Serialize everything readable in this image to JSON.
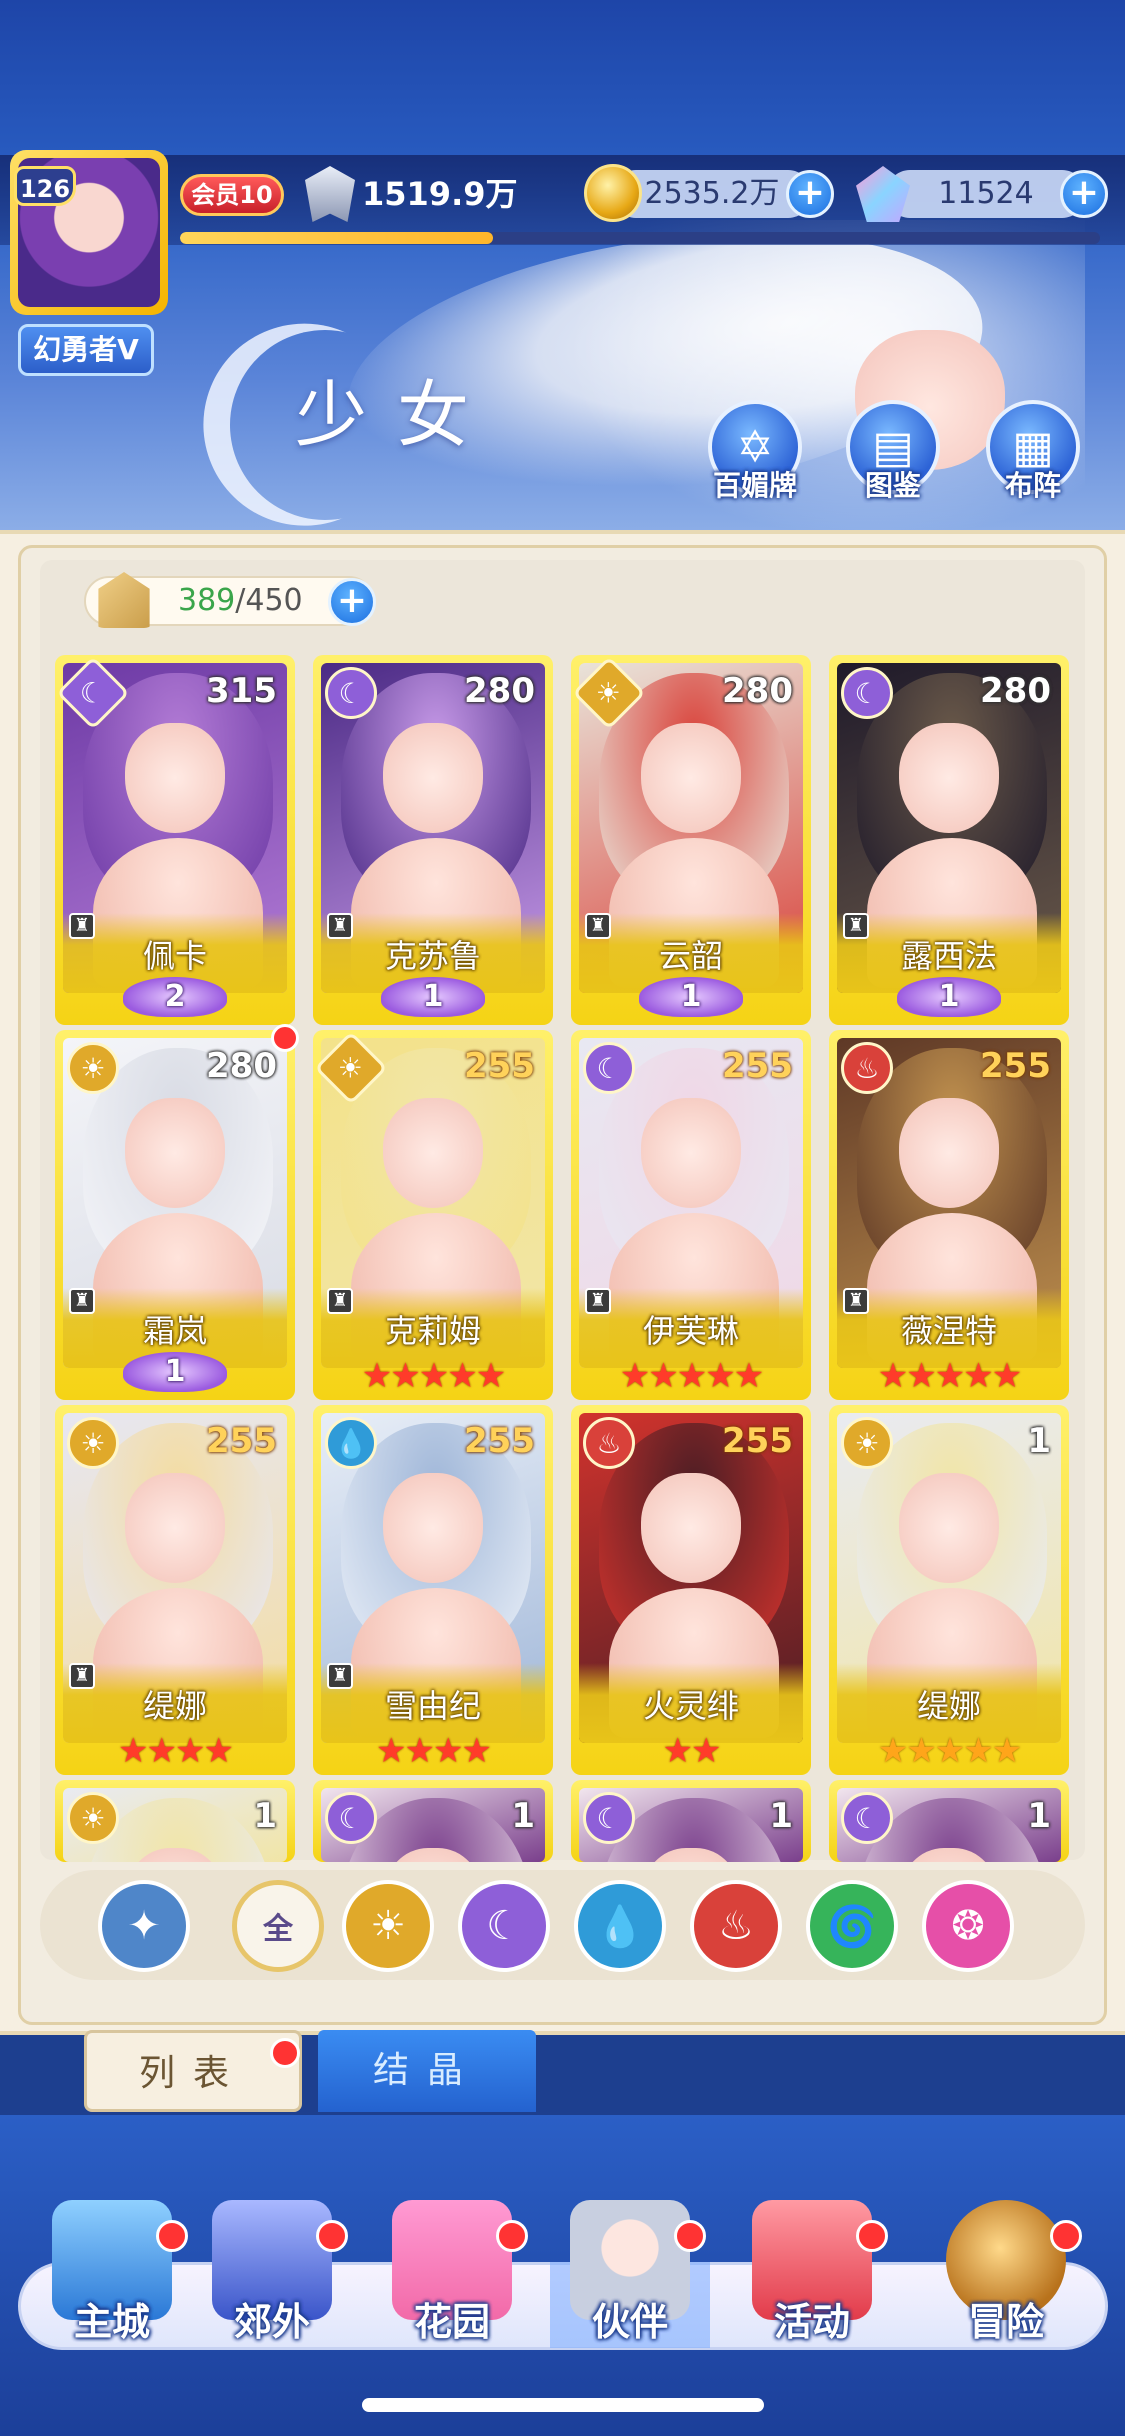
{
  "header": {
    "level": "126",
    "player_title": "幻勇者V",
    "vip": "会员10",
    "power": "1519.9万",
    "exp_progress": 0.34,
    "gold": "2535.2万",
    "gems": "11524",
    "plus_symbol": "+"
  },
  "page": {
    "title": "少女",
    "actions": [
      {
        "label": "百媚牌",
        "icon": "card-icon"
      },
      {
        "label": "图鉴",
        "icon": "book-icon"
      },
      {
        "label": "布阵",
        "icon": "grid-icon"
      }
    ]
  },
  "roster": {
    "count_current": "389",
    "count_total": "/450"
  },
  "cards": [
    {
      "name": "佩卡",
      "level": "315",
      "element": "moon",
      "wing": "2",
      "stars": 0
    },
    {
      "name": "克苏鲁",
      "level": "280",
      "element": "moon",
      "wing": "1",
      "stars": 0
    },
    {
      "name": "云韶",
      "level": "280",
      "element": "sun",
      "wing": "1",
      "stars": 0
    },
    {
      "name": "露西法",
      "level": "280",
      "element": "moon",
      "wing": "1",
      "stars": 0
    },
    {
      "name": "霜岚",
      "level": "280",
      "element": "sun",
      "wing": "1",
      "stars": 0,
      "alert": true
    },
    {
      "name": "克莉姆",
      "level": "255",
      "element": "sun",
      "stars": 5
    },
    {
      "name": "伊芙琳",
      "level": "255",
      "element": "moon",
      "stars": 5
    },
    {
      "name": "薇涅特",
      "level": "255",
      "element": "fire",
      "stars": 5
    },
    {
      "name": "缇娜",
      "level": "255",
      "element": "sun",
      "stars": 4
    },
    {
      "name": "雪由纪",
      "level": "255",
      "element": "water",
      "stars": 4
    },
    {
      "name": "火灵绯",
      "level": "255",
      "element": "fire",
      "stars": 2
    },
    {
      "name": "缇娜",
      "level": "1",
      "element": "sun",
      "stars": 5,
      "gold_stars": true
    },
    {
      "name": "",
      "level": "1",
      "element": "sun"
    },
    {
      "name": "",
      "level": "1",
      "element": "moon"
    },
    {
      "name": "",
      "level": "1",
      "element": "moon"
    },
    {
      "name": "",
      "level": "1",
      "element": "moon"
    }
  ],
  "filters": [
    {
      "name": "rank",
      "label": "",
      "color": "#4f86c9"
    },
    {
      "name": "all",
      "label": "全",
      "color": "#f9f4ea"
    },
    {
      "name": "sun",
      "label": "",
      "color": "#e0a92a"
    },
    {
      "name": "moon",
      "label": "",
      "color": "#8e5fd8"
    },
    {
      "name": "water",
      "label": "",
      "color": "#2f9bd8"
    },
    {
      "name": "fire",
      "label": "",
      "color": "#d9413a"
    },
    {
      "name": "wind",
      "label": "",
      "color": "#36b45a"
    },
    {
      "name": "heart",
      "label": "",
      "color": "#e64fa8"
    }
  ],
  "tabs": {
    "list": "列表",
    "crystal": "结晶"
  },
  "nav": [
    {
      "label": "主城",
      "icon": "castle-icon"
    },
    {
      "label": "郊外",
      "icon": "portal-icon"
    },
    {
      "label": "花园",
      "icon": "heart-icon"
    },
    {
      "label": "伙伴",
      "icon": "partner-icon"
    },
    {
      "label": "活动",
      "icon": "gift-icon"
    },
    {
      "label": "冒险",
      "icon": "compass-icon"
    }
  ]
}
